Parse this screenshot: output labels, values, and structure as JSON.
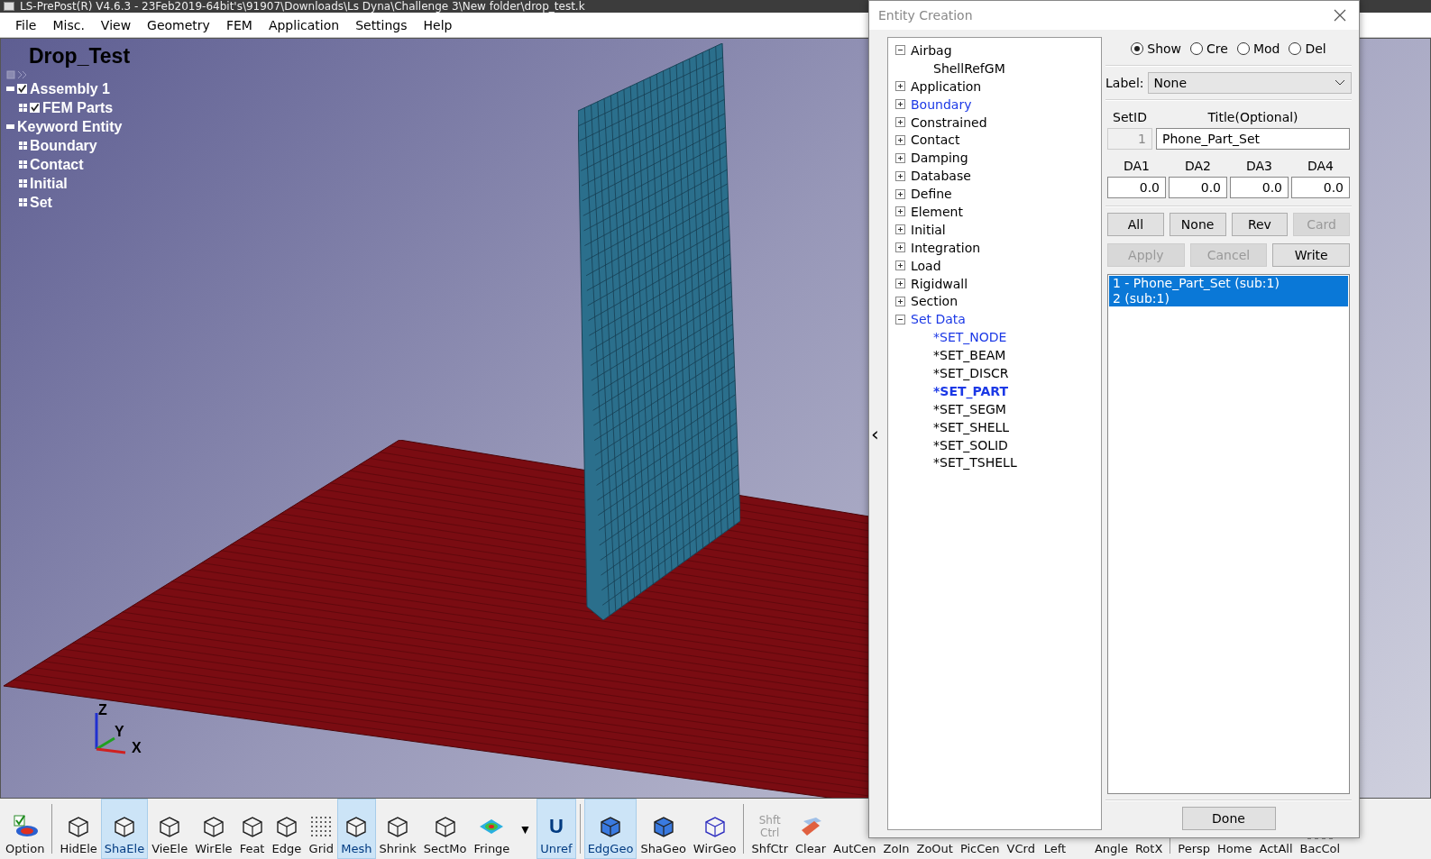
{
  "window": {
    "title": "LS-PrePost(R) V4.6.3 - 23Feb2019-64bit's\\91907\\Downloads\\Ls Dyna\\Challenge 3\\New folder\\drop_test.k"
  },
  "menu": [
    "File",
    "Misc.",
    "View",
    "Geometry",
    "FEM",
    "Application",
    "Settings",
    "Help"
  ],
  "viewport": {
    "model_title": "Drop_Test",
    "tree": [
      {
        "label": "Assembly 1",
        "checked": true,
        "expanded": true,
        "children": [
          {
            "label": "FEM Parts",
            "checked": true
          }
        ]
      },
      {
        "label": "Keyword Entity",
        "expanded": true,
        "children": [
          {
            "label": "Boundary"
          },
          {
            "label": "Contact"
          },
          {
            "label": "Initial"
          },
          {
            "label": "Set"
          }
        ]
      }
    ],
    "axes": [
      "Z",
      "Y",
      "X"
    ]
  },
  "toolbar": [
    {
      "label": "Option",
      "kind": "option",
      "active": false
    },
    {
      "label": "HidEle",
      "kind": "cube",
      "active": false,
      "separator": true
    },
    {
      "label": "ShaEle",
      "kind": "cube",
      "active": true
    },
    {
      "label": "VieEle",
      "kind": "cube",
      "active": false
    },
    {
      "label": "WirEle",
      "kind": "cube",
      "active": false
    },
    {
      "label": "Feat",
      "kind": "cube",
      "active": false
    },
    {
      "label": "Edge",
      "kind": "cube",
      "active": false
    },
    {
      "label": "Grid",
      "kind": "dots",
      "active": false
    },
    {
      "label": "Mesh",
      "kind": "cube",
      "active": true
    },
    {
      "label": "Shrink",
      "kind": "cube",
      "active": false
    },
    {
      "label": "SectMo",
      "kind": "cube",
      "active": false
    },
    {
      "label": "Fringe",
      "kind": "fringe",
      "active": false
    },
    {
      "label": "▼",
      "kind": "caret",
      "active": false
    },
    {
      "label": "Unref",
      "kind": "letter",
      "icon_text": "U",
      "active": true
    },
    {
      "label": "EdgGeo",
      "kind": "solid",
      "active": true,
      "separator": true
    },
    {
      "label": "ShaGeo",
      "kind": "solid",
      "active": false
    },
    {
      "label": "WirGeo",
      "kind": "wire",
      "active": false
    },
    {
      "label": "ShfCtr",
      "kind": "keys",
      "icon_lines": [
        "Shft",
        "Ctrl"
      ],
      "active": false,
      "separator": true
    },
    {
      "label": "Clear",
      "kind": "eraser",
      "active": false
    },
    {
      "label": "AutCen",
      "kind": "covered",
      "active": false
    },
    {
      "label": "ZoIn",
      "kind": "covered",
      "active": false
    },
    {
      "label": "ZoOut",
      "kind": "covered",
      "active": false
    },
    {
      "label": "PicCen",
      "kind": "covered",
      "active": false
    },
    {
      "label": "VCrd",
      "kind": "covered",
      "active": false
    },
    {
      "label": "Left",
      "kind": "covered",
      "active": false
    },
    {
      "label": "Angle",
      "kind": "covered",
      "active": false,
      "gap": true
    },
    {
      "label": "RotX",
      "kind": "covered",
      "active": false
    },
    {
      "label": "Persp",
      "kind": "covered",
      "active": false,
      "separator": true
    },
    {
      "label": "Home",
      "kind": "covered",
      "active": false
    },
    {
      "label": "ActAll",
      "kind": "covered",
      "active": false
    },
    {
      "label": "BacCol",
      "kind": "checker",
      "active": false
    }
  ],
  "dialog": {
    "title": "Entity Creation",
    "tree": [
      {
        "label": "Airbag",
        "expanded": true,
        "highlighted": false,
        "children": [
          {
            "label": "ShellRefGM",
            "selected": false,
            "highlighted": false
          }
        ]
      },
      {
        "label": "Application",
        "expanded": false,
        "highlighted": false
      },
      {
        "label": "Boundary",
        "expanded": false,
        "highlighted": true
      },
      {
        "label": "Constrained",
        "expanded": false,
        "highlighted": false
      },
      {
        "label": "Contact",
        "expanded": false,
        "highlighted": false
      },
      {
        "label": "Damping",
        "expanded": false,
        "highlighted": false
      },
      {
        "label": "Database",
        "expanded": false,
        "highlighted": false
      },
      {
        "label": "Define",
        "expanded": false,
        "highlighted": false
      },
      {
        "label": "Element",
        "expanded": false,
        "highlighted": false
      },
      {
        "label": "Initial",
        "expanded": false,
        "highlighted": false
      },
      {
        "label": "Integration",
        "expanded": false,
        "highlighted": false
      },
      {
        "label": "Load",
        "expanded": false,
        "highlighted": false
      },
      {
        "label": "Rigidwall",
        "expanded": false,
        "highlighted": false
      },
      {
        "label": "Section",
        "expanded": false,
        "highlighted": false
      },
      {
        "label": "Set Data",
        "expanded": true,
        "highlighted": true,
        "children": [
          {
            "label": "*SET_NODE",
            "selected": false,
            "highlighted": true
          },
          {
            "label": "*SET_BEAM",
            "selected": false,
            "highlighted": false
          },
          {
            "label": "*SET_DISCR",
            "selected": false,
            "highlighted": false
          },
          {
            "label": "*SET_PART",
            "selected": true,
            "highlighted": true
          },
          {
            "label": "*SET_SEGM",
            "selected": false,
            "highlighted": false
          },
          {
            "label": "*SET_SHELL",
            "selected": false,
            "highlighted": false
          },
          {
            "label": "*SET_SOLID",
            "selected": false,
            "highlighted": false
          },
          {
            "label": "*SET_TSHELL",
            "selected": false,
            "highlighted": false
          }
        ]
      }
    ],
    "modes": [
      {
        "label": "Show",
        "selected": true
      },
      {
        "label": "Cre",
        "selected": false
      },
      {
        "label": "Mod",
        "selected": false
      },
      {
        "label": "Del",
        "selected": false
      }
    ],
    "label_field": {
      "label": "Label:",
      "value": "None"
    },
    "setid": {
      "header": "SetID",
      "value": "1",
      "disabled": true
    },
    "title_field": {
      "header": "Title(Optional)",
      "value": "Phone_Part_Set"
    },
    "da_fields": [
      {
        "header": "DA1",
        "value": "0.0"
      },
      {
        "header": "DA2",
        "value": "0.0"
      },
      {
        "header": "DA3",
        "value": "0.0"
      },
      {
        "header": "DA4",
        "value": "0.0"
      }
    ],
    "buttons_row1": [
      {
        "label": "All",
        "disabled": false
      },
      {
        "label": "None",
        "disabled": false
      },
      {
        "label": "Rev",
        "disabled": false
      },
      {
        "label": "Card",
        "disabled": true
      }
    ],
    "buttons_row2": [
      {
        "label": "Apply",
        "disabled": true
      },
      {
        "label": "Cancel",
        "disabled": true
      },
      {
        "label": "Write",
        "disabled": false
      }
    ],
    "list": [
      {
        "label": "1 - Phone_Part_Set (sub:1)",
        "selected": true
      },
      {
        "label": "2 (sub:1)",
        "selected": true
      }
    ],
    "collapse": "‹",
    "done": "Done"
  }
}
